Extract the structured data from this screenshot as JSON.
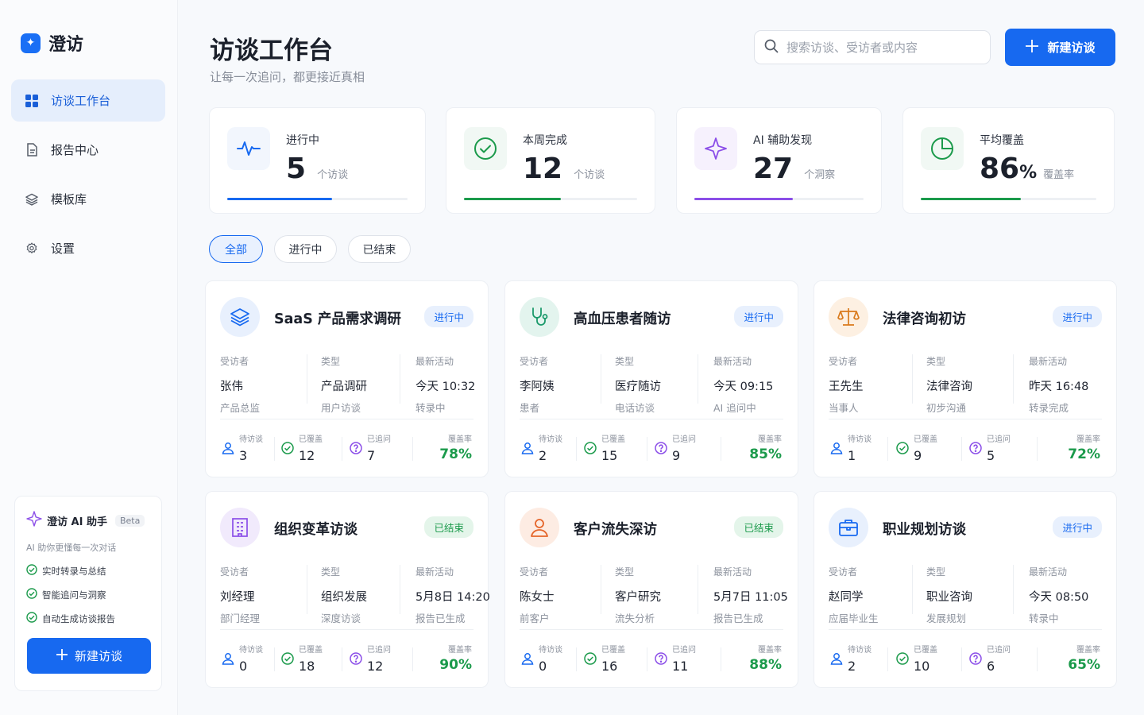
{
  "brand": {
    "name": "澄访",
    "logo_glyph": "✦"
  },
  "nav": [
    {
      "label": "访谈工作台",
      "icon": "grid-icon",
      "active": true
    },
    {
      "label": "报告中心",
      "icon": "document-icon",
      "active": false
    },
    {
      "label": "模板库",
      "icon": "layers-icon",
      "active": false
    },
    {
      "label": "设置",
      "icon": "gear-icon",
      "active": false
    }
  ],
  "assistant": {
    "title": "澄访 AI 助手",
    "badge": "Beta",
    "desc": "AI 助你更懂每一次对话",
    "features": [
      "实时转录与总结",
      "智能追问与洞察",
      "自动生成访谈报告"
    ],
    "button": "新建访谈"
  },
  "header": {
    "title": "访谈工作台",
    "subtitle": "让每一次追问，都更接近真相",
    "search_placeholder": "搜索访谈、受访者或内容",
    "new_button": "新建访谈"
  },
  "stats": [
    {
      "label": "进行中",
      "value": "5",
      "unit": "个访谈",
      "progress": 0.58,
      "color": "#1769f0"
    },
    {
      "label": "本周完成",
      "value": "12",
      "unit": "个访谈",
      "progress": 0.56,
      "color": "#1b9a4b"
    },
    {
      "label": "AI 辅助发现",
      "value": "27",
      "unit": "个洞察",
      "progress": 0.58,
      "color": "#8b4ee8"
    },
    {
      "label": "平均覆盖",
      "value": "86",
      "pct": "%",
      "unit": "覆盖率",
      "progress": 0.57,
      "color": "#1b9a4b"
    }
  ],
  "filters": [
    "全部",
    "进行中",
    "已结束"
  ],
  "labels": {
    "interviewee": "受访者",
    "type": "类型",
    "activity": "最新活动",
    "pending": "待访谈",
    "covered": "已覆盖",
    "followups": "已追问",
    "coverage": "覆盖率"
  },
  "cards": [
    {
      "title": "SaaS 产品需求调研",
      "status": "进行中",
      "status_kind": "active",
      "icon": "layers-icon",
      "icon_color": "#1769f0",
      "icon_bg": "#e8f0fd",
      "interviewee": "张伟",
      "role": "产品总监",
      "type": "产品调研",
      "type_sub": "用户访谈",
      "activity_time": "今天 10:32",
      "activity_desc": "转录中",
      "pending": "3",
      "covered": "12",
      "followups": "7",
      "coverage": "78%"
    },
    {
      "title": "高血压患者随访",
      "status": "进行中",
      "status_kind": "active",
      "icon": "stethoscope-icon",
      "icon_color": "#1b9a6b",
      "icon_bg": "#e3f4ee",
      "interviewee": "李阿姨",
      "role": "患者",
      "type": "医疗随访",
      "type_sub": "电话访谈",
      "activity_time": "今天 09:15",
      "activity_desc": "AI 追问中",
      "pending": "2",
      "covered": "15",
      "followups": "9",
      "coverage": "85%"
    },
    {
      "title": "法律咨询初访",
      "status": "进行中",
      "status_kind": "active",
      "icon": "scale-icon",
      "icon_color": "#d97a1c",
      "icon_bg": "#fdf0e2",
      "interviewee": "王先生",
      "role": "当事人",
      "type": "法律咨询",
      "type_sub": "初步沟通",
      "activity_time": "昨天 16:48",
      "activity_desc": "转录完成",
      "pending": "1",
      "covered": "9",
      "followups": "5",
      "coverage": "72%"
    },
    {
      "title": "组织变革访谈",
      "status": "已结束",
      "status_kind": "done",
      "icon": "building-icon",
      "icon_color": "#8b4ee8",
      "icon_bg": "#f1eafc",
      "interviewee": "刘经理",
      "role": "部门经理",
      "type": "组织发展",
      "type_sub": "深度访谈",
      "activity_time": "5月8日 14:20",
      "activity_desc": "报告已生成",
      "pending": "0",
      "covered": "18",
      "followups": "12",
      "coverage": "90%"
    },
    {
      "title": "客户流失深访",
      "status": "已结束",
      "status_kind": "done",
      "icon": "user-icon",
      "icon_color": "#e5652a",
      "icon_bg": "#fdece3",
      "interviewee": "陈女士",
      "role": "前客户",
      "type": "客户研究",
      "type_sub": "流失分析",
      "activity_time": "5月7日 11:05",
      "activity_desc": "报告已生成",
      "pending": "0",
      "covered": "16",
      "followups": "11",
      "coverage": "88%"
    },
    {
      "title": "职业规划访谈",
      "status": "进行中",
      "status_kind": "active",
      "icon": "briefcase-icon",
      "icon_color": "#1769f0",
      "icon_bg": "#e8f0fd",
      "interviewee": "赵同学",
      "role": "应届毕业生",
      "type": "职业咨询",
      "type_sub": "发展规划",
      "activity_time": "今天 08:50",
      "activity_desc": "转录中",
      "pending": "2",
      "covered": "10",
      "followups": "6",
      "coverage": "65%"
    }
  ]
}
